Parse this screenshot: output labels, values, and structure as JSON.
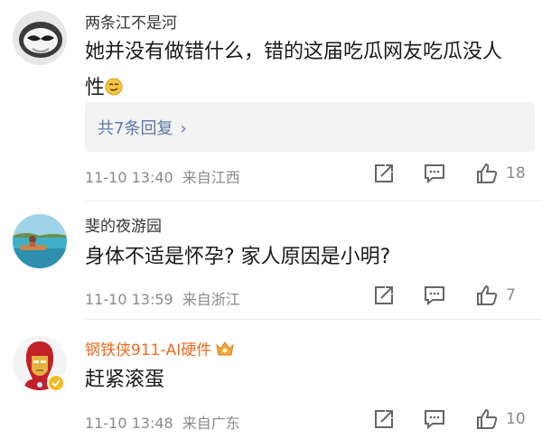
{
  "comments": [
    {
      "username": "两条江不是河",
      "text_line1": "她并没有做错什么，错的这届吃瓜网友吃瓜没人",
      "text_line2": "性",
      "emoji": "smirk-emoji",
      "replies_label": "共7条回复",
      "time": "11-10 13:40",
      "location": "来自江西",
      "likes": "18",
      "avatar": "mask-avatar"
    },
    {
      "username": "斐的夜游园",
      "text_line1": "身体不适是怀孕? 家人原因是小明?",
      "time": "11-10 13:59",
      "location": "来自浙江",
      "likes": "7",
      "avatar": "beach-avatar"
    },
    {
      "username": "钢铁侠911-AI硬件",
      "username_color": "#f06a1e",
      "badge": "vip-crown-icon",
      "text_line1": "赶紧滚蛋",
      "time": "11-10 13:48",
      "location": "来自广东",
      "likes": "10",
      "avatar": "ironman-avatar",
      "verified": "verified-badge"
    }
  ],
  "icons": {
    "repost": "repost-icon",
    "comment": "comment-icon",
    "like": "like-icon",
    "chevron": "chevron-right-icon"
  },
  "colors": {
    "link": "#5b7aa6",
    "vip_name": "#f06a1e",
    "meta": "#8a8a8a"
  }
}
